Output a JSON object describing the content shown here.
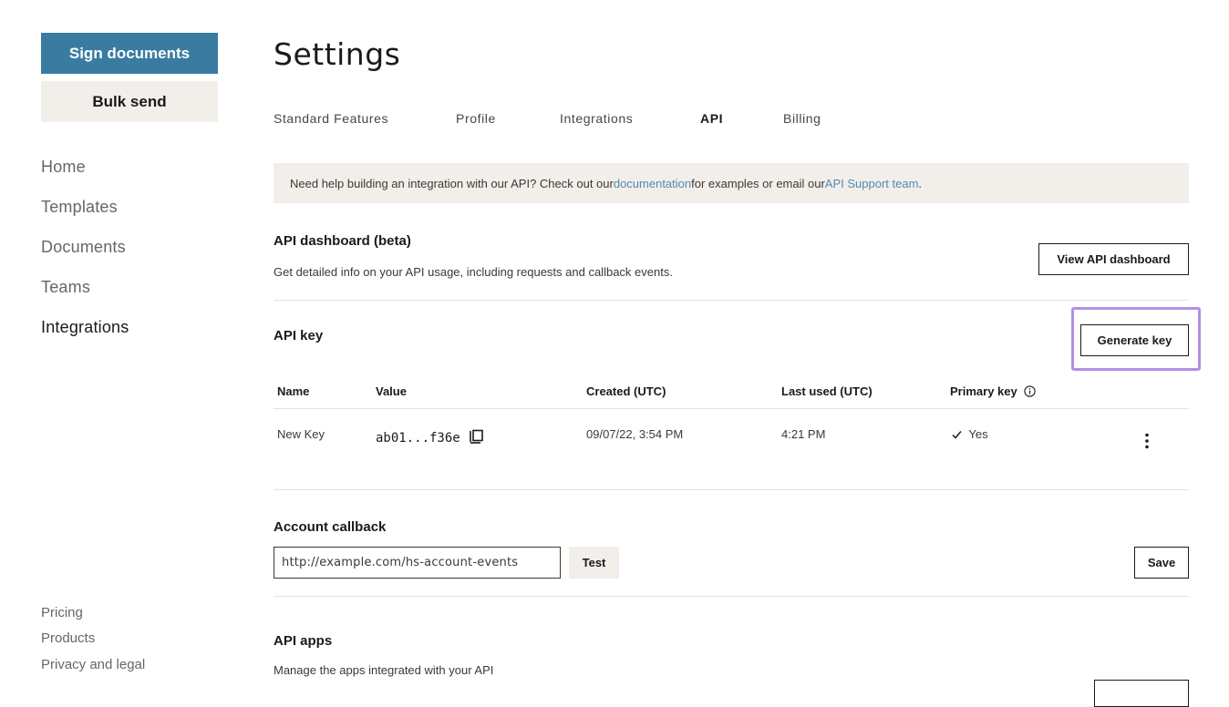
{
  "sidebar": {
    "primary_button": "Sign documents",
    "secondary_button": "Bulk send",
    "nav": [
      "Home",
      "Templates",
      "Documents",
      "Teams",
      "Integrations"
    ],
    "footer": [
      "Pricing",
      "Products",
      "Privacy and legal"
    ]
  },
  "page": {
    "title": "Settings",
    "tabs": [
      "Standard Features",
      "Profile",
      "Integrations",
      "API",
      "Billing"
    ],
    "active_tab": "API"
  },
  "banner": {
    "text_1": "Need help building an integration with our API? Check out our ",
    "link_1": "documentation",
    "text_2": " for examples or email our ",
    "link_2": "API Support team",
    "text_3": "."
  },
  "api_dashboard": {
    "title": "API dashboard (beta)",
    "description": "Get detailed info on your API usage, including requests and callback events.",
    "button": "View API dashboard"
  },
  "api_key": {
    "title": "API key",
    "generate_button": "Generate key",
    "columns": [
      "Name",
      "Value",
      "Created (UTC)",
      "Last used (UTC)",
      "Primary key"
    ],
    "row": {
      "name": "New Key",
      "value": "ab01...f36e",
      "created": "09/07/22, 3:54 PM",
      "last_used": "4:21 PM",
      "primary": "Yes"
    }
  },
  "account_callback": {
    "title": "Account callback",
    "url_value": "http://example.com/hs-account-events",
    "test_button": "Test",
    "save_button": "Save"
  },
  "api_apps": {
    "title": "API apps",
    "description": "Manage the apps integrated with your API"
  },
  "colors": {
    "brand_primary": "#3a7ca0",
    "link": "#4f8bb0",
    "highlight": "#b38ee6",
    "banner_bg": "#f2efeb"
  }
}
